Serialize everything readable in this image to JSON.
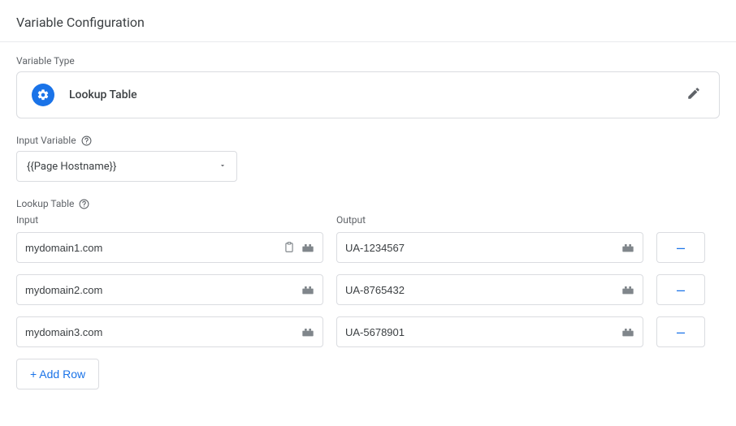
{
  "header": {
    "title": "Variable Configuration"
  },
  "variableType": {
    "label": "Variable Type",
    "name": "Lookup Table"
  },
  "inputVariable": {
    "label": "Input Variable",
    "value": "{{Page Hostname}}"
  },
  "lookupTable": {
    "label": "Lookup Table",
    "inputHeader": "Input",
    "outputHeader": "Output",
    "rows": [
      {
        "input": "mydomain1.com",
        "output": "UA-1234567"
      },
      {
        "input": "mydomain2.com",
        "output": "UA-8765432"
      },
      {
        "input": "mydomain3.com",
        "output": "UA-5678901"
      }
    ],
    "addRowLabel": "+ Add Row",
    "removeLabel": "–"
  }
}
